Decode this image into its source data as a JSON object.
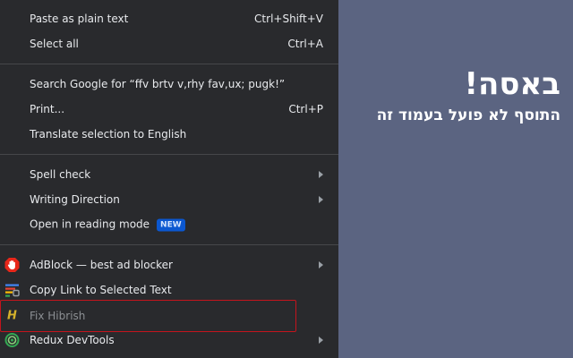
{
  "context_menu": {
    "paste_plain": {
      "label": "Paste as plain text",
      "shortcut": "Ctrl+Shift+V"
    },
    "select_all": {
      "label": "Select all",
      "shortcut": "Ctrl+A"
    },
    "search_google": {
      "label": "Search Google for “ffv brtv v,rhy fav,ux; pugk!”"
    },
    "print": {
      "label": "Print...",
      "shortcut": "Ctrl+P"
    },
    "translate": {
      "label": "Translate selection to English"
    },
    "spell_check": {
      "label": "Spell check"
    },
    "writing_direction": {
      "label": "Writing Direction"
    },
    "reading_mode": {
      "label": "Open in reading mode",
      "badge": "NEW"
    },
    "adblock": {
      "label": "AdBlock — best ad blocker",
      "icon": "adblock-hand-icon"
    },
    "copy_link": {
      "label": "Copy Link to Selected Text",
      "icon": "copy-link-text-icon"
    },
    "fix_hibrish": {
      "label": "Fix Hibrish",
      "icon_letter": "H"
    },
    "redux": {
      "label": "Redux DevTools",
      "icon": "redux-icon"
    }
  },
  "promo": {
    "title": "באסה!",
    "subtitle": "התוסף לא פועל בעמוד זה"
  },
  "colors": {
    "menu_bg": "#292a2d",
    "page_bg": "#5b6481",
    "highlight": "#c4141d",
    "badge_bg": "#0b57d0"
  }
}
